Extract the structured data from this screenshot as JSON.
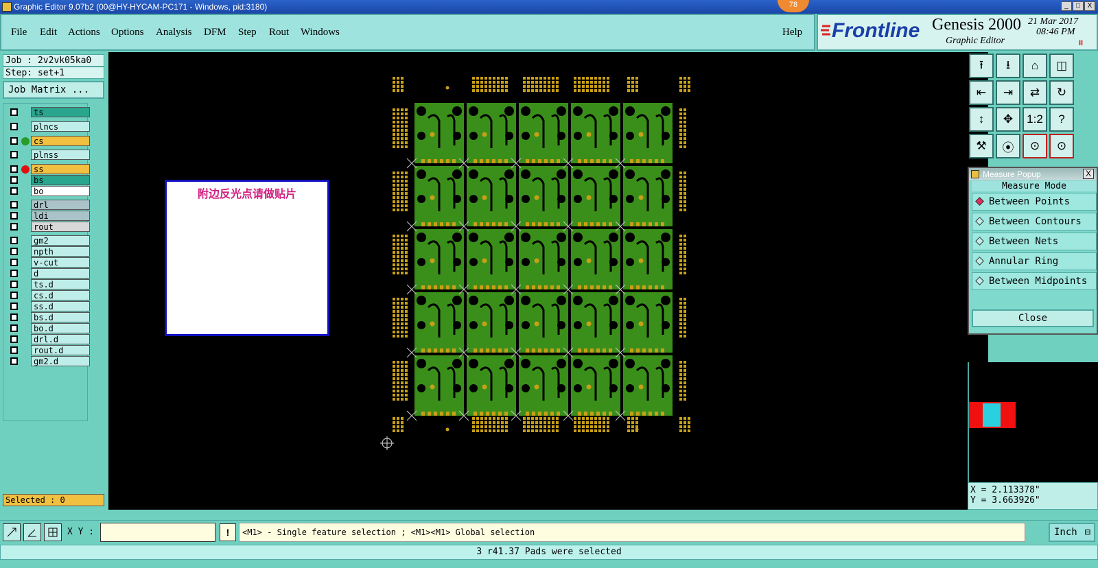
{
  "window": {
    "title": "Graphic Editor 9.07b2 (00@HY-HYCAM-PC171 - Windows, pid:3180)",
    "badge": "78",
    "min_label": "_",
    "max_label": "□",
    "close_label": "X"
  },
  "menu": {
    "items": [
      "File",
      "Edit",
      "Actions",
      "Options",
      "Analysis",
      "DFM",
      "Step",
      "Rout",
      "Windows"
    ],
    "help": "Help"
  },
  "brand": {
    "logo": "Frontline",
    "product": "Genesis 2000",
    "module": "Graphic Editor",
    "date": "21 Mar 2017",
    "time": "08:46 PM",
    "indicator": "II"
  },
  "job": {
    "job_label": "Job : 2v2vk05ka0",
    "step_label": "Step: set+1",
    "matrix_button": "Job Matrix ..."
  },
  "layers": [
    {
      "name": "ts",
      "bg": "#2aa58e",
      "dot": ""
    },
    {
      "name": "plncs",
      "bg": "#bfeeea",
      "dot": ""
    },
    {
      "name": "cs",
      "bg": "#f2c040",
      "dot": "#2a9a2a"
    },
    {
      "name": "plnss",
      "bg": "#bfeeea",
      "dot": ""
    },
    {
      "name": "ss",
      "bg": "#f2c040",
      "dot": "#e01010"
    },
    {
      "name": "bs",
      "bg": "#2aa58e",
      "dot": ""
    },
    {
      "name": "bo",
      "bg": "#ffffff",
      "dot": ""
    },
    {
      "name": "drl",
      "bg": "#a9c3c8",
      "dot": ""
    },
    {
      "name": "ldi",
      "bg": "#a9c3c8",
      "dot": ""
    },
    {
      "name": "rout",
      "bg": "#d8d8d8",
      "dot": ""
    },
    {
      "name": "gm2",
      "bg": "#bfeeea",
      "dot": ""
    },
    {
      "name": "npth",
      "bg": "#bfeeea",
      "dot": ""
    },
    {
      "name": "v-cut",
      "bg": "#bfeeea",
      "dot": ""
    },
    {
      "name": "d",
      "bg": "#bfeeea",
      "dot": ""
    },
    {
      "name": "ts.d",
      "bg": "#bfeeea",
      "dot": ""
    },
    {
      "name": "cs.d",
      "bg": "#bfeeea",
      "dot": ""
    },
    {
      "name": "ss.d",
      "bg": "#bfeeea",
      "dot": ""
    },
    {
      "name": "bs.d",
      "bg": "#bfeeea",
      "dot": ""
    },
    {
      "name": "bo.d",
      "bg": "#bfeeea",
      "dot": ""
    },
    {
      "name": "drl.d",
      "bg": "#bfeeea",
      "dot": ""
    },
    {
      "name": "rout.d",
      "bg": "#bfeeea",
      "dot": ""
    },
    {
      "name": "gm2.d",
      "bg": "#bfeeea",
      "dot": ""
    }
  ],
  "selected_label": "Selected : 0",
  "canvas": {
    "note": "附边反光点请做贴片",
    "board_rows": 5,
    "board_cols": 5,
    "colors": {
      "board": "#3a8f1a",
      "copper": "#c8a018",
      "background": "#000000"
    }
  },
  "toolbar_icons": [
    "pan-up-icon",
    "pan-down-icon",
    "home-icon",
    "split-view-icon",
    "pan-left-icon",
    "pan-right-icon",
    "zoom-ratio-icon",
    "redraw-icon",
    "fit-icon",
    "zoom-center-icon",
    "scale-1-2-icon",
    "help-icon",
    "wrench-icon",
    "probe-icon",
    "net-select-icon",
    "net-highlight-icon"
  ],
  "toolbar_glyphs": [
    "⭱",
    "⭳",
    "⌂",
    "◫",
    "⇤",
    "⇥",
    "⇄",
    "↻",
    "↕",
    "✥",
    "1:2",
    "?",
    "⚒",
    "⦿",
    "⊙",
    "⊙"
  ],
  "measure": {
    "title": "Measure Popup",
    "mode_label": "Measure Mode",
    "options": [
      "Between Points",
      "Between Contours",
      "Between Nets",
      "Annular Ring",
      "Between Midpoints"
    ],
    "selected_index": 0,
    "close_button": "Close"
  },
  "coords": {
    "x": "X = 2.113378\"",
    "y": "Y = 3.663926\""
  },
  "command": {
    "xy_label": "X Y :",
    "xy_value": "",
    "hint": "<M1> - Single feature selection ; <M1><M1> Global selection",
    "unit": "Inch",
    "warn_icon": "!"
  },
  "status": "3 r41.37 Pads were selected"
}
